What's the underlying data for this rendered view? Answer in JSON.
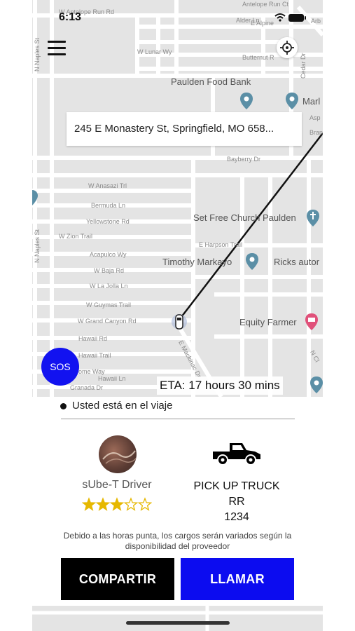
{
  "status_bar": {
    "time": "6:13"
  },
  "map": {
    "streets": {
      "antelope_run_rd": "W Antelope Run Rd",
      "antelope_run_ct": "Antelope Run Ct",
      "e_alpine": "E Alpine",
      "arb": "Arb",
      "w_lunar_wy": "W Lunar Wy",
      "alder_ln": "Alder Ln",
      "butternut": "Butternut R",
      "cedar_dr": "Cedar Dr",
      "n_naples_st": "N Naples St",
      "bayberry_dr": "Bayberry Dr",
      "w_anasazi_trl": "W Anasazi Trl",
      "bermuda_ln": "Bermuda Ln",
      "yellowstone_rd": "Yellowstone Rd",
      "w_zion_trail": "W Zion Trail",
      "acapulco_wy": "Acapulco Wy",
      "w_baja_rd": "W Baja Rd",
      "w_la_jolla_ln": "W La Jolla Ln",
      "w_guymas_trail": "W Guymas Trail",
      "w_grand_canyon_rd": "W Grand Canyon Rd",
      "hawaii_rd": "Hawaii Rd",
      "hawaii_trail": "Hawaii Trail",
      "hawaii_ln": "Hawaii Ln",
      "granada_dr": "Granada Dr",
      "some_way": "ome Way",
      "e_harpson_trail": "E Harpson Trail",
      "e_mackinac_dr": "E Mackinac Dr",
      "aspen": "Asp",
      "bran": "Bran",
      "n_cl": "N Cl",
      "n_naples_bottom": "N Naples",
      "ns_bottom": "N Na"
    },
    "pois": {
      "paulden_food_bank": "Paulden Food Bank",
      "marl": "Marl",
      "set_free_church": "Set Free Church Paulden",
      "timothy_markayo": "Timothy Markayo",
      "ricks_auto": "Ricks autor",
      "equity_farmer": "Equity Farmer"
    },
    "destination_address": "245 E Monastery St, Springfield, MO 658...",
    "sos_label": "SOS",
    "eta_text": "ETA: 17 hours 30 mins",
    "colors": {
      "map_bg": "#e4e4e4",
      "road": "#ffffff",
      "pin": "#5b8fa6",
      "pink_pin": "#e0517a",
      "route": "#111111"
    }
  },
  "trip": {
    "status": "Usted está en el viaje",
    "driver": {
      "name": "sUbe-T Driver",
      "rating": 3,
      "rating_max": 5
    },
    "vehicle": {
      "type": "PICK UP TRUCK",
      "line2": "RR",
      "plate": "1234"
    },
    "notice": "Debido a las horas punta, los cargos serán variados según la disponibilidad del proveedor",
    "buttons": {
      "share": "COMPARTIR",
      "call": "LLAMAR"
    },
    "colors": {
      "share_bg": "#000000",
      "call_bg": "#0c0cf0",
      "sos_bg": "#1212f0",
      "star": "#e6b800"
    }
  }
}
